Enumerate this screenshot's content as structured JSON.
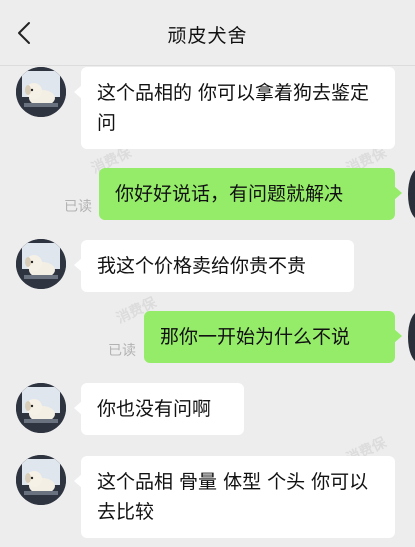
{
  "chat": {
    "title": "顽皮犬舍",
    "back_icon": "chevron-left-icon",
    "watermark": "消费保",
    "read_label": "已读",
    "messages": [
      {
        "side": "in",
        "text": "这个品相的 你可以拿着狗去鉴定问"
      },
      {
        "side": "out",
        "text": "你好好说话，有问题就解决",
        "status": "已读"
      },
      {
        "side": "in",
        "text": "我这个价格卖给你贵不贵"
      },
      {
        "side": "out",
        "text": "那你一开始为什么不说",
        "status": "已读"
      },
      {
        "side": "in",
        "text": "你也没有问啊"
      },
      {
        "side": "in",
        "text": "这个品相 骨量 体型 个头 你可以去比较"
      }
    ]
  },
  "colors": {
    "background": "#ededed",
    "incoming_bubble": "#ffffff",
    "outgoing_bubble": "#95ec69",
    "read_status": "#b2b2b2"
  }
}
